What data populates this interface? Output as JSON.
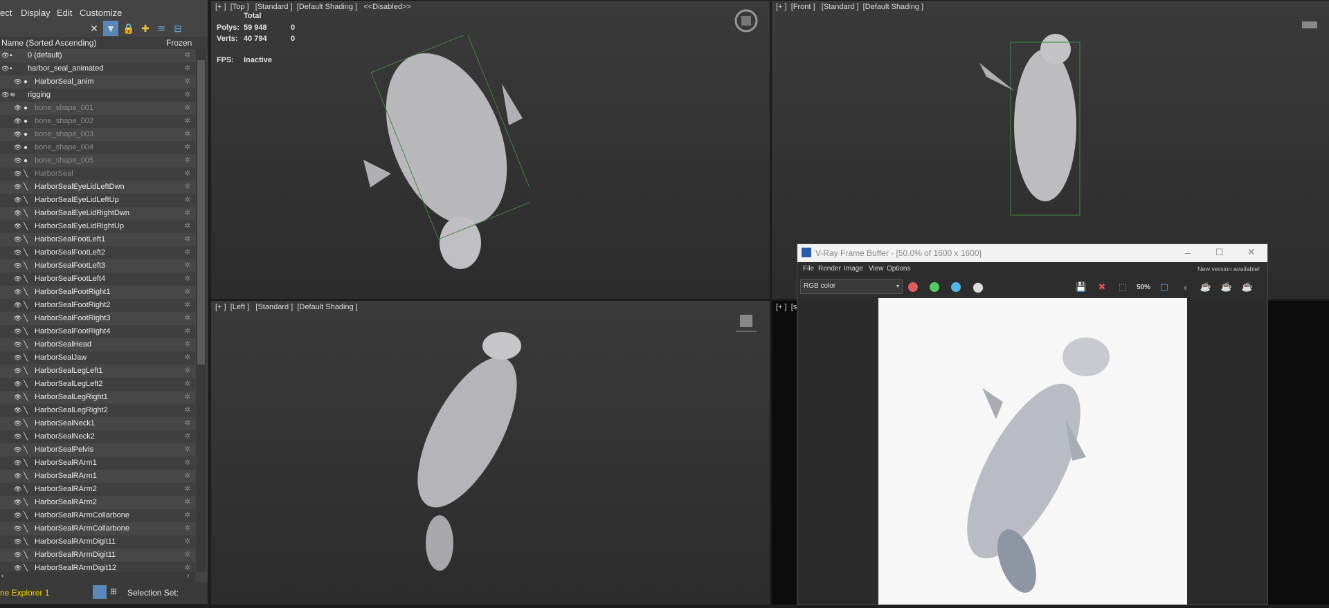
{
  "explorer": {
    "menu": [
      "ect",
      "Display",
      "Edit",
      "Customize"
    ],
    "column_name": "Name (Sorted Ascending)",
    "column_frozen": "Frozen",
    "rows": [
      {
        "label": "0 (default)",
        "level": "top",
        "dim": false,
        "icon": "layer-icon"
      },
      {
        "label": "harbor_seal_animated",
        "level": "top",
        "dim": false,
        "icon": "layer-icon"
      },
      {
        "label": "HarborSeal_anim",
        "level": "child",
        "dim": false,
        "icon": "sphere-icon"
      },
      {
        "label": "rigging",
        "level": "top",
        "dim": false,
        "icon": "layer-stack-icon"
      },
      {
        "label": "bone_shape_001",
        "level": "child",
        "dim": true,
        "icon": "sphere-icon"
      },
      {
        "label": "bone_shape_002",
        "level": "child",
        "dim": true,
        "icon": "sphere-icon"
      },
      {
        "label": "bone_shape_003",
        "level": "child",
        "dim": true,
        "icon": "sphere-icon"
      },
      {
        "label": "bone_shape_004",
        "level": "child",
        "dim": true,
        "icon": "sphere-icon"
      },
      {
        "label": "bone_shape_005",
        "level": "child",
        "dim": true,
        "icon": "sphere-icon"
      },
      {
        "label": "HarborSeal",
        "level": "child",
        "dim": true,
        "icon": "bone-icon"
      },
      {
        "label": "HarborSealEyeLidLeftDwn",
        "level": "child",
        "dim": false,
        "icon": "bone-icon"
      },
      {
        "label": "HarborSealEyeLidLeftUp",
        "level": "child",
        "dim": false,
        "icon": "bone-icon"
      },
      {
        "label": "HarborSealEyeLidRightDwn",
        "level": "child",
        "dim": false,
        "icon": "bone-icon"
      },
      {
        "label": "HarborSealEyeLidRightUp",
        "level": "child",
        "dim": false,
        "icon": "bone-icon"
      },
      {
        "label": "HarborSealFootLeft1",
        "level": "child",
        "dim": false,
        "icon": "bone-icon"
      },
      {
        "label": "HarborSealFootLeft2",
        "level": "child",
        "dim": false,
        "icon": "bone-icon"
      },
      {
        "label": "HarborSealFootLeft3",
        "level": "child",
        "dim": false,
        "icon": "bone-icon"
      },
      {
        "label": "HarborSealFootLeft4",
        "level": "child",
        "dim": false,
        "icon": "bone-icon"
      },
      {
        "label": "HarborSealFootRight1",
        "level": "child",
        "dim": false,
        "icon": "bone-icon"
      },
      {
        "label": "HarborSealFootRight2",
        "level": "child",
        "dim": false,
        "icon": "bone-icon"
      },
      {
        "label": "HarborSealFootRight3",
        "level": "child",
        "dim": false,
        "icon": "bone-icon"
      },
      {
        "label": "HarborSealFootRight4",
        "level": "child",
        "dim": false,
        "icon": "bone-icon"
      },
      {
        "label": "HarborSealHead",
        "level": "child",
        "dim": false,
        "icon": "bone-icon"
      },
      {
        "label": "HarborSealJaw",
        "level": "child",
        "dim": false,
        "icon": "bone-icon"
      },
      {
        "label": "HarborSealLegLeft1",
        "level": "child",
        "dim": false,
        "icon": "bone-icon"
      },
      {
        "label": "HarborSealLegLeft2",
        "level": "child",
        "dim": false,
        "icon": "bone-icon"
      },
      {
        "label": "HarborSealLegRight1",
        "level": "child",
        "dim": false,
        "icon": "bone-icon"
      },
      {
        "label": "HarborSealLegRight2",
        "level": "child",
        "dim": false,
        "icon": "bone-icon"
      },
      {
        "label": "HarborSealNeck1",
        "level": "child",
        "dim": false,
        "icon": "bone-icon"
      },
      {
        "label": "HarborSealNeck2",
        "level": "child",
        "dim": false,
        "icon": "bone-icon"
      },
      {
        "label": "HarborSealPelvis",
        "level": "child",
        "dim": false,
        "icon": "bone-icon"
      },
      {
        "label": "HarborSealRArm1",
        "level": "child",
        "dim": false,
        "icon": "bone-icon"
      },
      {
        "label": "HarborSealRArm1",
        "level": "child",
        "dim": false,
        "icon": "bone-icon"
      },
      {
        "label": "HarborSealRArm2",
        "level": "child",
        "dim": false,
        "icon": "bone-icon"
      },
      {
        "label": "HarborSealRArm2",
        "level": "child",
        "dim": false,
        "icon": "bone-icon"
      },
      {
        "label": "HarborSealRArmCollarbone",
        "level": "child",
        "dim": false,
        "icon": "bone-icon"
      },
      {
        "label": "HarborSealRArmCollarbone",
        "level": "child",
        "dim": false,
        "icon": "bone-icon"
      },
      {
        "label": "HarborSealRArmDigit11",
        "level": "child",
        "dim": false,
        "icon": "bone-icon"
      },
      {
        "label": "HarborSealRArmDigit11",
        "level": "child",
        "dim": false,
        "icon": "bone-icon"
      },
      {
        "label": "HarborSealRArmDigit12",
        "level": "child",
        "dim": false,
        "icon": "bone-icon"
      }
    ],
    "footer_name": "ne Explorer 1",
    "footer_selection": "Selection Set:"
  },
  "viewports": {
    "top": {
      "label": "[+ ]  [Top ]   [Standard ]  [Default Shading ]   <<Disabled>>"
    },
    "front": {
      "label": "[+ ]  [Front ]   [Standard ]  [Default Shading ]"
    },
    "left": {
      "label": "[+ ]  [Left ]   [Standard ]  [Default Shading ]"
    },
    "persp": {
      "label": "[+ ]  [si"
    }
  },
  "stats": {
    "total_label": "Total",
    "polys_label": "Polys:",
    "polys_value": "59 948",
    "polys_sel": "0",
    "verts_label": "Verts:",
    "verts_value": "40 794",
    "verts_sel": "0",
    "fps_label": "FPS:",
    "fps_value": "Inactive"
  },
  "vfb": {
    "title": "V-Ray Frame Buffer - [50.0% of 1600 x 1600]",
    "menu": [
      "File",
      "Render",
      "Image",
      "View",
      "Options"
    ],
    "notice": "New version available!",
    "channel": "RGB color",
    "zoom_badge": "50%",
    "dot_colors": [
      "#e35b5b",
      "#57c967",
      "#52b8e8"
    ]
  }
}
